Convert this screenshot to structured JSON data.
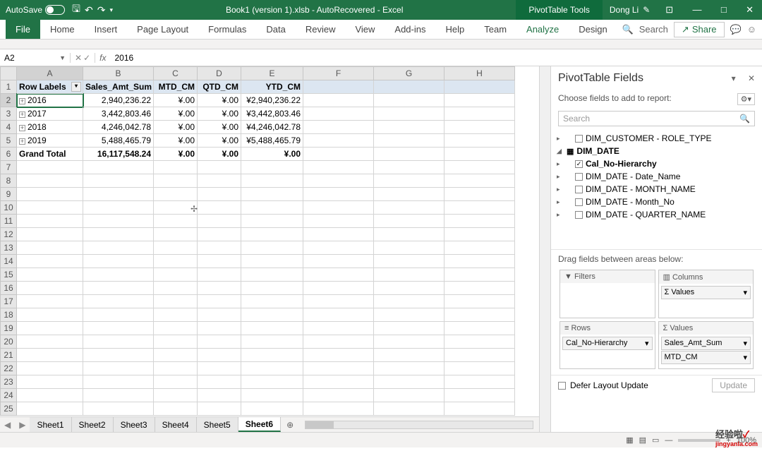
{
  "titlebar": {
    "autosave": "AutoSave",
    "title": "Book1 (version 1).xlsb  -  AutoRecovered  -  Excel",
    "tools": "PivotTable Tools",
    "user": "Dong Li"
  },
  "ribbon": {
    "tabs": [
      "File",
      "Home",
      "Insert",
      "Page Layout",
      "Formulas",
      "Data",
      "Review",
      "View",
      "Add-ins",
      "Help",
      "Team",
      "Analyze",
      "Design"
    ],
    "search": "Search",
    "share": "Share"
  },
  "namebox": "A2",
  "formula": "2016",
  "columns": [
    "A",
    "B",
    "C",
    "D",
    "E",
    "F",
    "G",
    "H"
  ],
  "rows": [
    {
      "n": 1,
      "A": "Row Labels",
      "B": "Sales_Amt_Sum",
      "C": "MTD_CM",
      "D": "QTD_CM",
      "E": "YTD_CM",
      "hdr": true
    },
    {
      "n": 2,
      "A": "2016",
      "B": "2,940,236.22",
      "C": "¥.00",
      "D": "¥.00",
      "E": "¥2,940,236.22",
      "exp": true,
      "active": true
    },
    {
      "n": 3,
      "A": "2017",
      "B": "3,442,803.46",
      "C": "¥.00",
      "D": "¥.00",
      "E": "¥3,442,803.46",
      "exp": true
    },
    {
      "n": 4,
      "A": "2018",
      "B": "4,246,042.78",
      "C": "¥.00",
      "D": "¥.00",
      "E": "¥4,246,042.78",
      "exp": true
    },
    {
      "n": 5,
      "A": "2019",
      "B": "5,488,465.79",
      "C": "¥.00",
      "D": "¥.00",
      "E": "¥5,488,465.79",
      "exp": true
    },
    {
      "n": 6,
      "A": "Grand Total",
      "B": "16,117,548.24",
      "C": "¥.00",
      "D": "¥.00",
      "E": "¥.00",
      "bold": true
    }
  ],
  "empty_rows": [
    7,
    8,
    9,
    10,
    11,
    12,
    13,
    14,
    15,
    16,
    17,
    18,
    19,
    20,
    21,
    22,
    23,
    24,
    25
  ],
  "sheets": [
    "Sheet1",
    "Sheet2",
    "Sheet3",
    "Sheet4",
    "Sheet5",
    "Sheet6"
  ],
  "active_sheet": "Sheet6",
  "pane": {
    "title": "PivotTable Fields",
    "subtitle": "Choose fields to add to report:",
    "search_ph": "Search",
    "fields": [
      {
        "label": "DIM_CUSTOMER - ROLE_TYPE",
        "checked": false,
        "child": true,
        "tri": "▸"
      },
      {
        "label": "DIM_DATE",
        "group": true,
        "tri": "◢"
      },
      {
        "label": "Cal_No-Hierarchy",
        "checked": true,
        "child": true,
        "bold": true,
        "tri": "▸"
      },
      {
        "label": "DIM_DATE - Date_Name",
        "checked": false,
        "child": true,
        "tri": "▸"
      },
      {
        "label": "DIM_DATE - MONTH_NAME",
        "checked": false,
        "child": true,
        "tri": "▸"
      },
      {
        "label": "DIM_DATE - Month_No",
        "checked": false,
        "child": true,
        "tri": "▸"
      },
      {
        "label": "DIM_DATE - QUARTER_NAME",
        "checked": false,
        "child": true,
        "tri": "▸"
      }
    ],
    "areas_hdr": "Drag fields between areas below:",
    "filters": "Filters",
    "columns": "Columns",
    "rows_label": "Rows",
    "values_label": "Values",
    "col_items": [
      "Values"
    ],
    "row_items": [
      "Cal_No-Hierarchy"
    ],
    "val_items": [
      "Sales_Amt_Sum",
      "MTD_CM"
    ],
    "defer": "Defer Layout Update",
    "update": "Update"
  },
  "watermark": {
    "main": "经验啦",
    "check": "✓",
    "sub": "jingyanla.com"
  },
  "statusbar": {
    "ready": "",
    "zoom": "100%"
  }
}
